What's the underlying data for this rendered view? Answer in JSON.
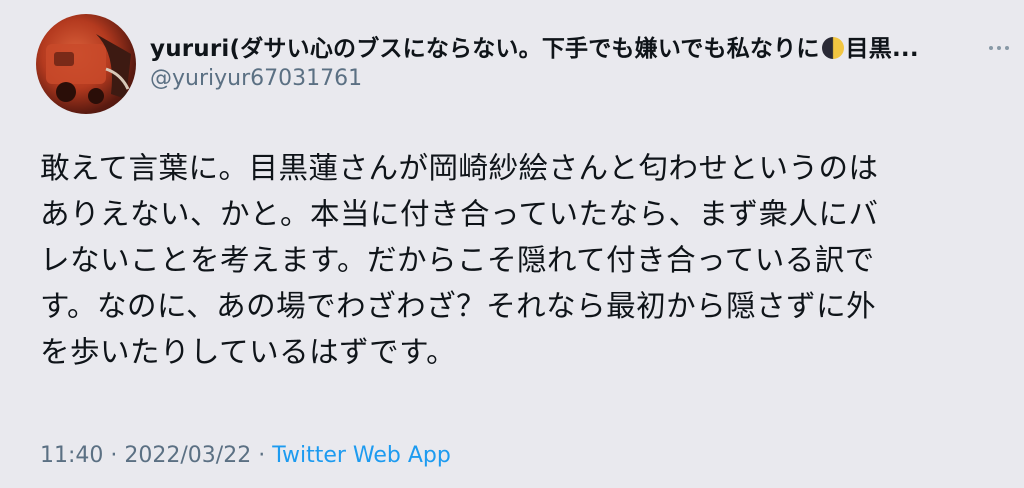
{
  "author": {
    "name": "yururi(ダサい心のブスにならない。下手でも嫌いでも私なりに",
    "name_tail": "目黒...",
    "name_emoji": "moon-icon",
    "handle": "@yuriyur67031761"
  },
  "tweet": {
    "lines": [
      "敢えて言葉に。目黒蓮さんが岡崎紗絵さんと匂わせというのは",
      "ありえない、かと。本当に付き合っていたなら、まず衆人にバ",
      "レないことを考えます。だからこそ隠れて付き合っている訳で",
      "す。なのに、あの場でわざわざ？それなら最初から隠さずに外",
      "を歩いたりしているはずです。"
    ]
  },
  "meta": {
    "time": "11:40",
    "sep1": " · ",
    "date": "2022/03/22",
    "sep2": " · ",
    "source": "Twitter Web App"
  },
  "colors": {
    "background": "#e9e9ee",
    "text": "#0f1419",
    "secondary": "#5b7083",
    "link": "#1d9bf0"
  }
}
